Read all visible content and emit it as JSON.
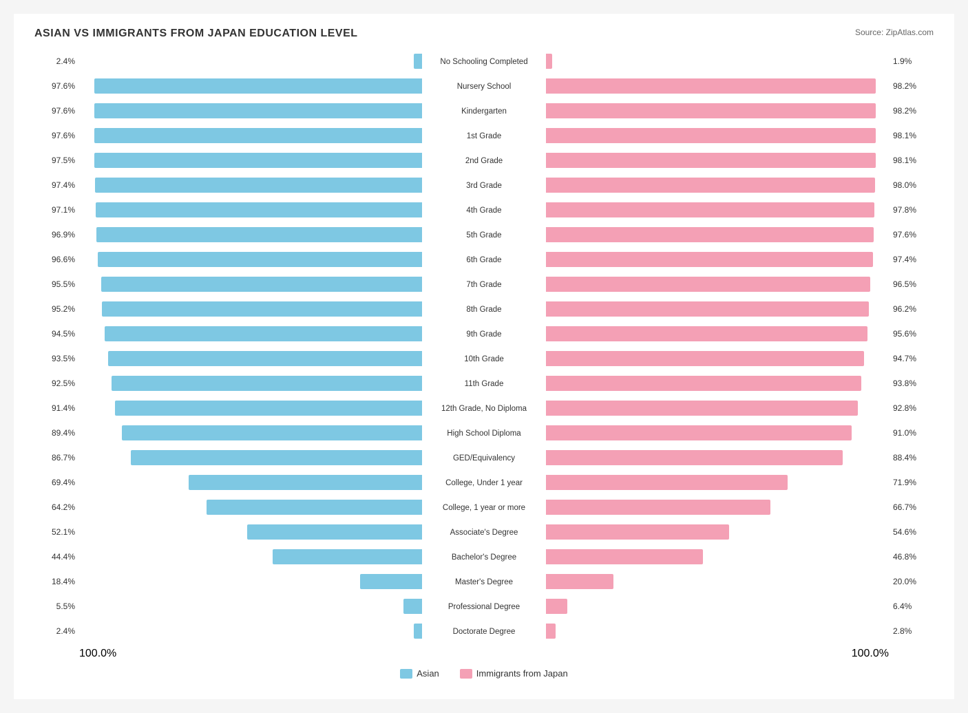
{
  "title": "ASIAN VS IMMIGRANTS FROM JAPAN EDUCATION LEVEL",
  "source": "Source: ZipAtlas.com",
  "legend": {
    "asian_label": "Asian",
    "japan_label": "Immigrants from Japan"
  },
  "bottom_labels": {
    "left": "100.0%",
    "right": "100.0%"
  },
  "rows": [
    {
      "label": "No Schooling Completed",
      "left": "2.4%",
      "right": "1.9%",
      "left_pct": 2.4,
      "right_pct": 1.9
    },
    {
      "label": "Nursery School",
      "left": "97.6%",
      "right": "98.2%",
      "left_pct": 97.6,
      "right_pct": 98.2
    },
    {
      "label": "Kindergarten",
      "left": "97.6%",
      "right": "98.2%",
      "left_pct": 97.6,
      "right_pct": 98.2
    },
    {
      "label": "1st Grade",
      "left": "97.6%",
      "right": "98.1%",
      "left_pct": 97.6,
      "right_pct": 98.1
    },
    {
      "label": "2nd Grade",
      "left": "97.5%",
      "right": "98.1%",
      "left_pct": 97.5,
      "right_pct": 98.1
    },
    {
      "label": "3rd Grade",
      "left": "97.4%",
      "right": "98.0%",
      "left_pct": 97.4,
      "right_pct": 98.0
    },
    {
      "label": "4th Grade",
      "left": "97.1%",
      "right": "97.8%",
      "left_pct": 97.1,
      "right_pct": 97.8
    },
    {
      "label": "5th Grade",
      "left": "96.9%",
      "right": "97.6%",
      "left_pct": 96.9,
      "right_pct": 97.6
    },
    {
      "label": "6th Grade",
      "left": "96.6%",
      "right": "97.4%",
      "left_pct": 96.6,
      "right_pct": 97.4
    },
    {
      "label": "7th Grade",
      "left": "95.5%",
      "right": "96.5%",
      "left_pct": 95.5,
      "right_pct": 96.5
    },
    {
      "label": "8th Grade",
      "left": "95.2%",
      "right": "96.2%",
      "left_pct": 95.2,
      "right_pct": 96.2
    },
    {
      "label": "9th Grade",
      "left": "94.5%",
      "right": "95.6%",
      "left_pct": 94.5,
      "right_pct": 95.6
    },
    {
      "label": "10th Grade",
      "left": "93.5%",
      "right": "94.7%",
      "left_pct": 93.5,
      "right_pct": 94.7
    },
    {
      "label": "11th Grade",
      "left": "92.5%",
      "right": "93.8%",
      "left_pct": 92.5,
      "right_pct": 93.8
    },
    {
      "label": "12th Grade, No Diploma",
      "left": "91.4%",
      "right": "92.8%",
      "left_pct": 91.4,
      "right_pct": 92.8
    },
    {
      "label": "High School Diploma",
      "left": "89.4%",
      "right": "91.0%",
      "left_pct": 89.4,
      "right_pct": 91.0
    },
    {
      "label": "GED/Equivalency",
      "left": "86.7%",
      "right": "88.4%",
      "left_pct": 86.7,
      "right_pct": 88.4
    },
    {
      "label": "College, Under 1 year",
      "left": "69.4%",
      "right": "71.9%",
      "left_pct": 69.4,
      "right_pct": 71.9
    },
    {
      "label": "College, 1 year or more",
      "left": "64.2%",
      "right": "66.7%",
      "left_pct": 64.2,
      "right_pct": 66.7
    },
    {
      "label": "Associate's Degree",
      "left": "52.1%",
      "right": "54.6%",
      "left_pct": 52.1,
      "right_pct": 54.6
    },
    {
      "label": "Bachelor's Degree",
      "left": "44.4%",
      "right": "46.8%",
      "left_pct": 44.4,
      "right_pct": 46.8
    },
    {
      "label": "Master's Degree",
      "left": "18.4%",
      "right": "20.0%",
      "left_pct": 18.4,
      "right_pct": 20.0
    },
    {
      "label": "Professional Degree",
      "left": "5.5%",
      "right": "6.4%",
      "left_pct": 5.5,
      "right_pct": 6.4
    },
    {
      "label": "Doctorate Degree",
      "left": "2.4%",
      "right": "2.8%",
      "left_pct": 2.4,
      "right_pct": 2.8
    }
  ]
}
